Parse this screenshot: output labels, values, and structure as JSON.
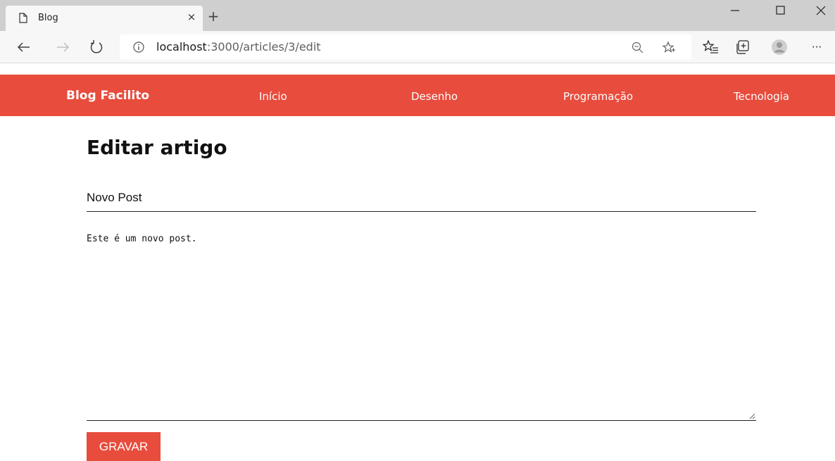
{
  "browser": {
    "tab_title": "Blog",
    "tab_close": "×",
    "new_tab": "+",
    "url_host": "localhost",
    "url_rest": ":3000/articles/3/edit",
    "more": "···",
    "icons": [
      "document-icon",
      "back-icon",
      "forward-icon",
      "refresh-icon",
      "info-icon",
      "zoom-out-icon",
      "favorite-icon",
      "favorites-list-icon",
      "collections-icon",
      "profile-icon",
      "more-icon",
      "minimize-icon",
      "maximize-icon",
      "close-icon"
    ]
  },
  "navbar": {
    "brand": "Blog Facilito",
    "links": [
      "Início",
      "Desenho",
      "Programação",
      "Tecnologia"
    ],
    "background": "#e84c3d"
  },
  "page": {
    "heading": "Editar artigo",
    "title_value": "Novo Post",
    "body_value": "Este é um novo post.",
    "save_label": "GRAVAR"
  }
}
